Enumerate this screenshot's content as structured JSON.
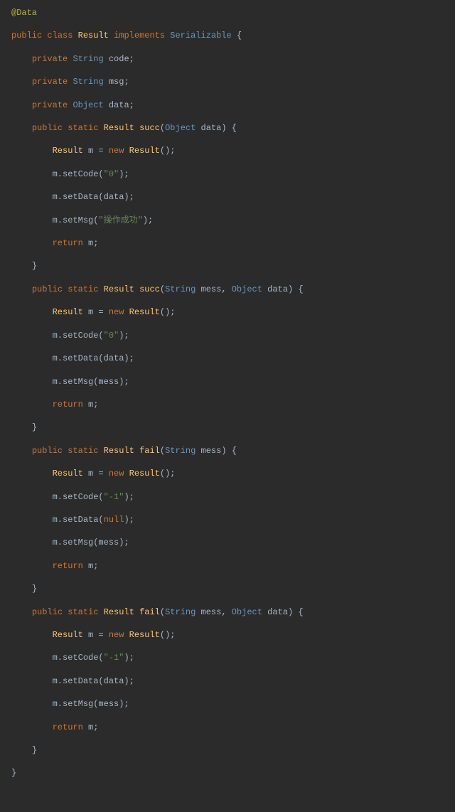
{
  "annotation": "@Data",
  "decl": {
    "public": "public",
    "class": "class",
    "name": "Result",
    "implements": "implements",
    "iface": "Serializable",
    "open": "{"
  },
  "fields": [
    {
      "vis": "private",
      "type": "String",
      "name": "code;"
    },
    {
      "vis": "private",
      "type": "String",
      "name": "msg;"
    },
    {
      "vis": "private",
      "type": "Object",
      "name": "data;"
    }
  ],
  "m1": {
    "sig": {
      "vis": "public",
      "static": "static",
      "ret": "Result",
      "name": "succ",
      "lp": "(",
      "p1t": "Object",
      "p1n": "data",
      "rp": ") {"
    },
    "l1": {
      "type": "Result",
      "var": "m = ",
      "new": "new",
      "ctor": "Result",
      "rest": "();"
    },
    "l2_a": "m.setCode(",
    "l2_s": "\"0\"",
    "l2_b": ");",
    "l3": "m.setData(data);",
    "l4_a": "m.setMsg(",
    "l4_s": "\"操作成功\"",
    "l4_b": ");",
    "l5_k": "return",
    "l5_r": " m;",
    "close": "}"
  },
  "m2": {
    "sig": {
      "vis": "public",
      "static": "static",
      "ret": "Result",
      "name": "succ",
      "lp": "(",
      "p1t": "String",
      "p1n": "mess, ",
      "p2t": "Object",
      "p2n": "data",
      "rp": ") {"
    },
    "l1": {
      "type": "Result",
      "var": "m = ",
      "new": "new",
      "ctor": "Result",
      "rest": "();"
    },
    "l2_a": "m.setCode(",
    "l2_s": "\"0\"",
    "l2_b": ");",
    "l3": "m.setData(data);",
    "l4": "m.setMsg(mess);",
    "l5_k": "return",
    "l5_r": " m;",
    "close": "}"
  },
  "m3": {
    "sig": {
      "vis": "public",
      "static": "static",
      "ret": "Result",
      "name": "fail",
      "lp": "(",
      "p1t": "String",
      "p1n": "mess",
      "rp": ") {"
    },
    "l1": {
      "type": "Result",
      "var": "m = ",
      "new": "new",
      "ctor": "Result",
      "rest": "();"
    },
    "l2_a": "m.setCode(",
    "l2_s": "\"-1\"",
    "l2_b": ");",
    "l3_a": "m.setData(",
    "l3_k": "null",
    "l3_b": ");",
    "l4": "m.setMsg(mess);",
    "l5_k": "return",
    "l5_r": " m;",
    "close": "}"
  },
  "m4": {
    "sig": {
      "vis": "public",
      "static": "static",
      "ret": "Result",
      "name": "fail",
      "lp": "(",
      "p1t": "String",
      "p1n": "mess, ",
      "p2t": "Object",
      "p2n": "data",
      "rp": ") {"
    },
    "l1": {
      "type": "Result",
      "var": "m = ",
      "new": "new",
      "ctor": "Result",
      "rest": "();"
    },
    "l2_a": "m.setCode(",
    "l2_s": "\"-1\"",
    "l2_b": ");",
    "l3": "m.setData(data);",
    "l4": "m.setMsg(mess);",
    "l5_k": "return",
    "l5_r": " m;",
    "close": "}"
  },
  "class_close": "}"
}
